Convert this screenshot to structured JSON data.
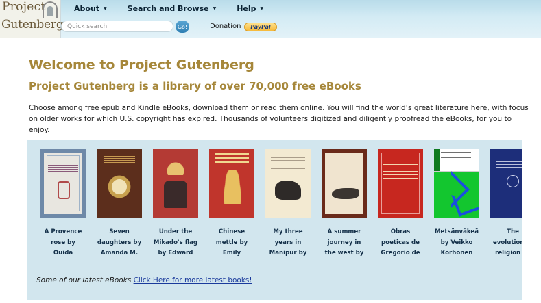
{
  "header": {
    "logo": {
      "line1": "Project",
      "line2": "Gutenberg"
    },
    "nav": [
      {
        "label": "About"
      },
      {
        "label": "Search and Browse"
      },
      {
        "label": "Help"
      }
    ],
    "search": {
      "placeholder": "Quick search",
      "button": "Go!"
    },
    "donation": "Donation",
    "paypal": "PayPal"
  },
  "main": {
    "title": "Welcome to Project Gutenberg",
    "subtitle": "Project Gutenberg is a library of over 70,000 free eBooks",
    "intro": "Choose among free epub and Kindle eBooks, download them or read them online. You will find the world’s great literature here, with focus on older works for which U.S. copyright has expired. Thousands of volunteers digitized and diligently proofread the eBooks, for you to enjoy."
  },
  "latest": {
    "books": [
      {
        "title": "A Provence rose by Ouida"
      },
      {
        "title": "Seven daughters by Amanda M."
      },
      {
        "title": "Under the Mikado's flag by Edward"
      },
      {
        "title": "Chinese mettle by Emily"
      },
      {
        "title": "My three years in Manipur by"
      },
      {
        "title": "A summer journey in the west by Eliza"
      },
      {
        "title": "Obras poeticas de Gregorio de"
      },
      {
        "title": "Metsänväkeä by Veikko Korhonen"
      },
      {
        "title": "The evolution of religion by Lewis Richard"
      }
    ],
    "lead": "Some of our latest eBooks",
    "more_link": "Click Here for more latest books!"
  },
  "colors": {
    "header_bg": "#cde7f1",
    "title": "#a6873a",
    "panel_bg": "#d2e6ee",
    "caption": "#15314a",
    "link": "#1a3a9c"
  }
}
